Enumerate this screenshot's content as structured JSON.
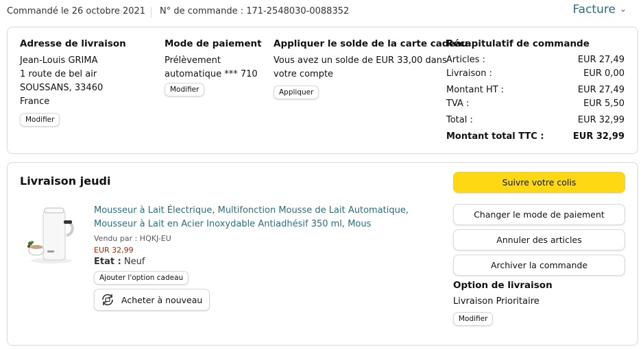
{
  "header": {
    "order_date": "Commandé le 26 octobre 2021",
    "order_number": "N° de commande : 171-2548030-0088352",
    "invoice_label": "Facture"
  },
  "shipping": {
    "title": "Adresse de livraison",
    "lines": [
      "Jean-Louis GRIMA",
      "1 route de bel air",
      "SOUSSANS, 33460",
      "France"
    ],
    "edit_label": "Modifier"
  },
  "payment": {
    "title": "Mode de paiement",
    "lines": [
      "Prélèvement",
      "automatique *** 710"
    ],
    "edit_label": "Modifier"
  },
  "gift_card": {
    "title": "Appliquer le solde de la carte cadeau",
    "lines": [
      "Vous avez un solde de EUR 33,00 dans",
      "votre compte"
    ],
    "apply_label": "Appliquer"
  },
  "summary": {
    "title": "Récapitulatif de commande",
    "rows": [
      {
        "label": "Articles :",
        "value": "EUR 27,49"
      },
      {
        "label": "Livraison :",
        "value": "EUR 0,00"
      },
      {
        "label": "Montant HT :",
        "value": "EUR 27,49"
      },
      {
        "label": "TVA :",
        "value": "EUR 5,50"
      },
      {
        "label": "Total :",
        "value": "EUR 32,99"
      },
      {
        "label": "Montant total TTC :",
        "value": "EUR 32,99"
      }
    ]
  },
  "delivery": {
    "title": "Livraison jeudi",
    "product": {
      "title_line1": "Mousseur à Lait Électrique, Multifonction Mousse de Lait Automatique,",
      "title_line2": "Mousseur à Lait en Acier Inoxydable Antiadhésif 350 ml, Mous",
      "seller": "Vendu par : HQKJ-EU",
      "price": "EUR 32,99",
      "condition_label": "Etat :",
      "condition_value": "Neuf",
      "gift_option_label": "Ajouter l'option cadeau",
      "buy_again_label": "Acheter à nouveau"
    },
    "actions": {
      "track": "Suivre votre colis",
      "change_payment": "Changer le mode de paiement",
      "cancel": "Annuler des articles",
      "archive": "Archiver la commande"
    },
    "option": {
      "title": "Option de livraison",
      "value": "Livraison Prioritaire",
      "edit_label": "Modifier"
    }
  },
  "colors": {
    "link": "#2a6f80",
    "price": "#b12704",
    "primary_button": "#ffd814",
    "border": "#d5d9d9"
  }
}
